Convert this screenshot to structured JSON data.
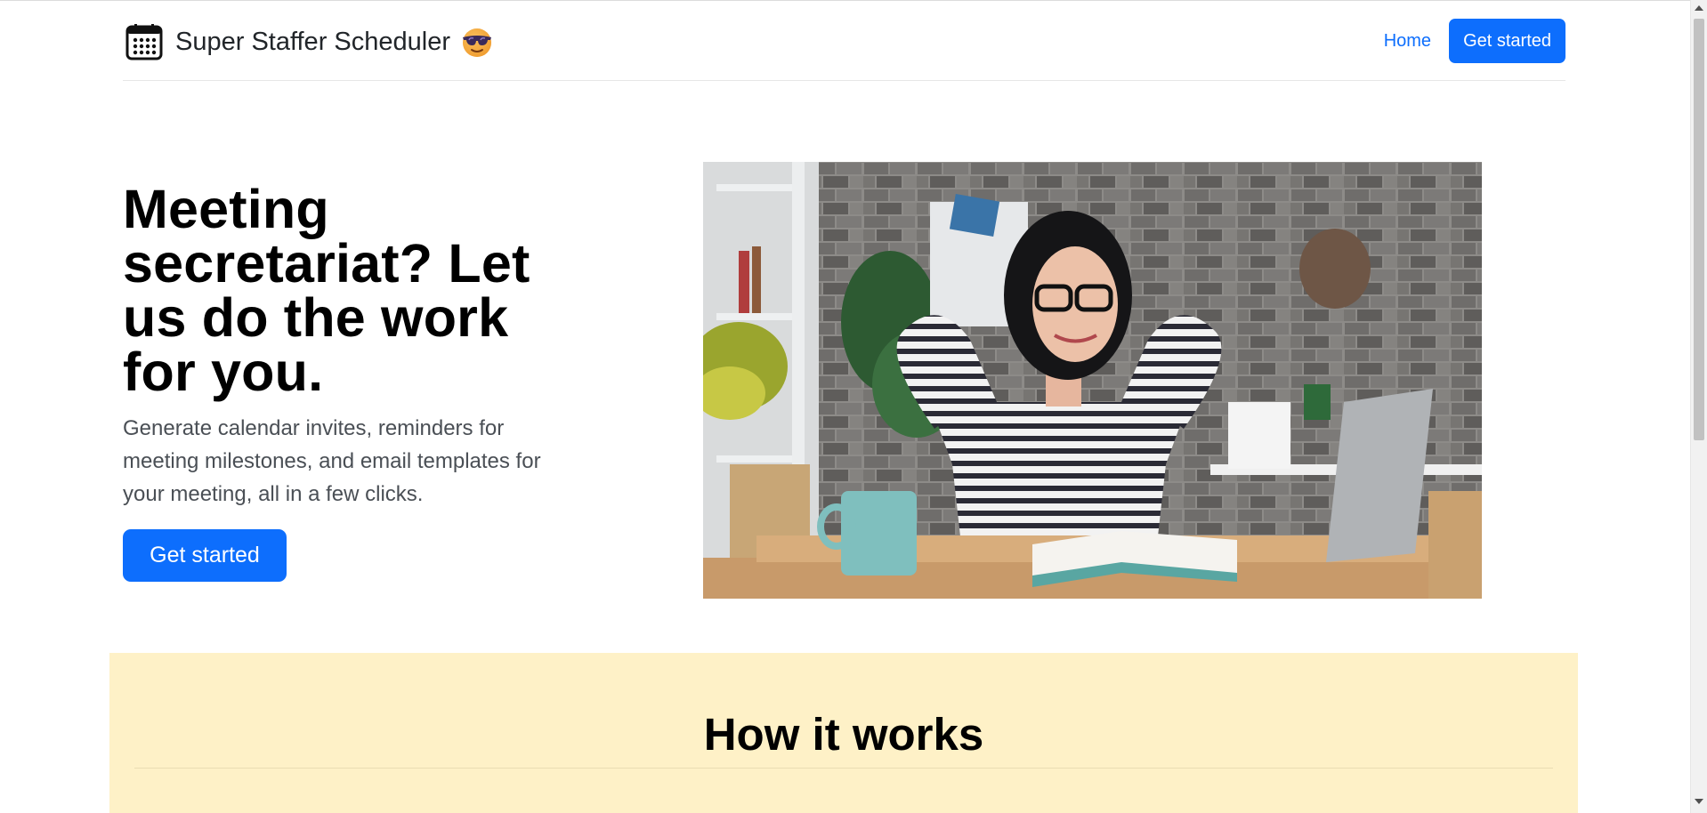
{
  "header": {
    "brand_title": "Super Staffer Scheduler",
    "brand_icon": "calendar-icon",
    "brand_emoji": "sunglasses-face-emoji",
    "nav_home": "Home",
    "nav_cta": "Get started"
  },
  "hero": {
    "title": "Meeting secretariat? Let us do the work for you.",
    "lead": "Generate calendar invites, reminders for meeting milestones, and email templates for your meeting, all in a few clicks.",
    "cta": "Get started",
    "image": "photo of woman relaxing at desk with laptop"
  },
  "how_it_works": {
    "title": "How it works"
  },
  "colors": {
    "primary": "#0d6efd",
    "section_bg": "#fef1c7",
    "text": "#212529"
  }
}
